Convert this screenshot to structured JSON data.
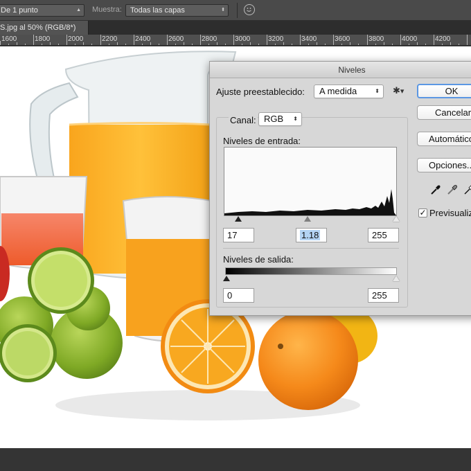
{
  "options_bar": {
    "sample_size_value": "De 1 punto",
    "sample_label": "Muestra:",
    "sample_value": "Todas las capas"
  },
  "document_tab": {
    "title": "S.jpg al 50% (RGB/8*)"
  },
  "ruler": {
    "ticks": [
      "1600",
      "1800",
      "2000",
      "2200",
      "2400",
      "2600",
      "2800",
      "3000",
      "3200",
      "3400",
      "3600",
      "3800",
      "4000",
      "4200"
    ]
  },
  "dialog": {
    "title": "Niveles",
    "preset_label": "Ajuste preestablecido:",
    "preset_value": "A medida",
    "channel_label": "Canal:",
    "channel_value": "RGB",
    "input_levels_label": "Niveles de entrada:",
    "input_black": "17",
    "input_gamma": "1.18",
    "input_white": "255",
    "output_levels_label": "Niveles de salida:",
    "output_black": "0",
    "output_white": "255",
    "ok_label": "OK",
    "cancel_label": "Cancelar",
    "auto_label": "Automático",
    "options_label": "Opciones...",
    "preview_label": "Previsualizar",
    "preview_checked": true
  },
  "colors": {
    "accent": "#5b97e3",
    "canvas": "#ffffff",
    "chrome": "#4a4a4a"
  }
}
